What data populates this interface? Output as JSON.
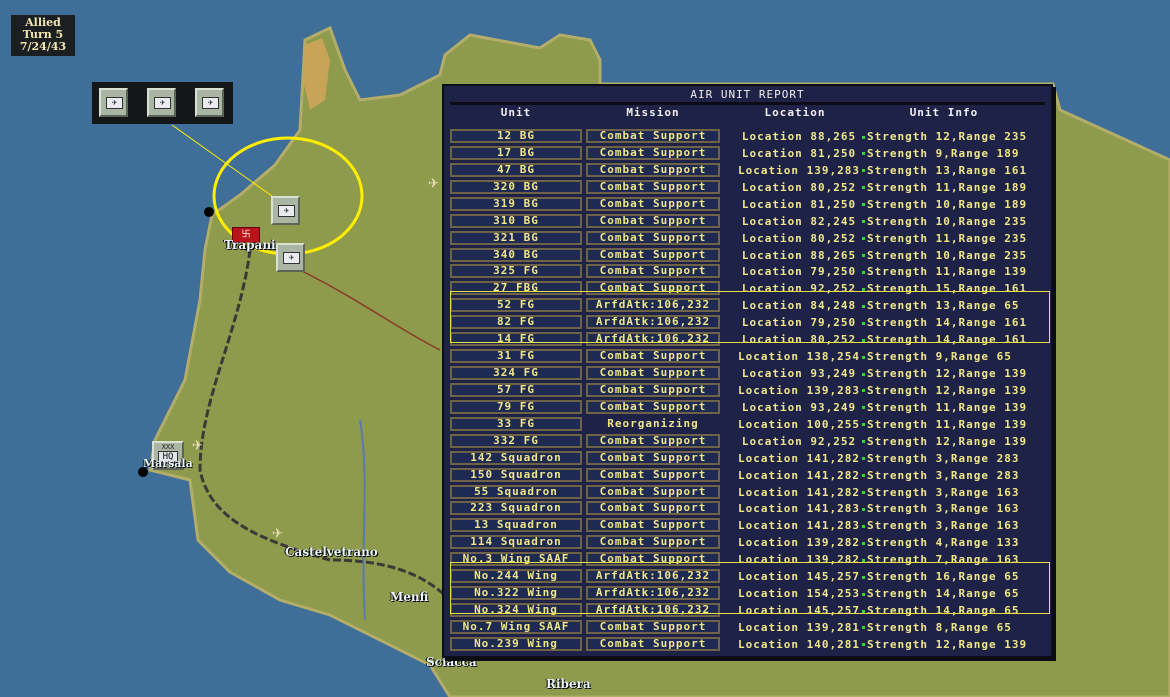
{
  "turn_info": {
    "side": "Allied",
    "turn": "Turn 5",
    "date": "7/24/43"
  },
  "map": {
    "labels": [
      "Trapani",
      "Marsala",
      "Castelvetrano",
      "Menfi",
      "Sciacca",
      "Ribera"
    ],
    "hq_label": "HQ",
    "hq_size": "XXX",
    "colors": {
      "sea": "#3f6f99",
      "land": "#8e9a4c",
      "selection": "#ffee00"
    }
  },
  "report": {
    "title": "AIR UNIT REPORT",
    "headers": [
      "Unit",
      "Mission",
      "Location",
      "Unit Info"
    ],
    "rows": [
      {
        "unit": "12 BG",
        "mission": "Combat Support",
        "location": "Location 88,265",
        "info": "Strength 12,Range 235"
      },
      {
        "unit": "17 BG",
        "mission": "Combat Support",
        "location": "Location 81,250",
        "info": "Strength 9,Range 189"
      },
      {
        "unit": "47 BG",
        "mission": "Combat Support",
        "location": "Location 139,283",
        "info": "Strength 13,Range 161"
      },
      {
        "unit": "320 BG",
        "mission": "Combat Support",
        "location": "Location 80,252",
        "info": "Strength 11,Range 189"
      },
      {
        "unit": "319 BG",
        "mission": "Combat Support",
        "location": "Location 81,250",
        "info": "Strength 10,Range 189"
      },
      {
        "unit": "310 BG",
        "mission": "Combat Support",
        "location": "Location 82,245",
        "info": "Strength 10,Range 235"
      },
      {
        "unit": "321 BG",
        "mission": "Combat Support",
        "location": "Location 80,252",
        "info": "Strength 11,Range 235"
      },
      {
        "unit": "340 BG",
        "mission": "Combat Support",
        "location": "Location 88,265",
        "info": "Strength 10,Range 235"
      },
      {
        "unit": "325 FG",
        "mission": "Combat Support",
        "location": "Location 79,250",
        "info": "Strength 11,Range 139"
      },
      {
        "unit": "27 FBG",
        "mission": "Combat Support",
        "location": "Location 92,252",
        "info": "Strength 15,Range 161"
      },
      {
        "unit": "52 FG",
        "mission": "ArfdAtk:106,232",
        "location": "Location 84,248",
        "info": "Strength 13,Range 65"
      },
      {
        "unit": "82 FG",
        "mission": "ArfdAtk:106,232",
        "location": "Location 79,250",
        "info": "Strength 14,Range 161"
      },
      {
        "unit": "14 FG",
        "mission": "ArfdAtk:106,232",
        "location": "Location 80,252",
        "info": "Strength 14,Range 161"
      },
      {
        "unit": "31 FG",
        "mission": "Combat Support",
        "location": "Location 138,254",
        "info": "Strength 9,Range 65"
      },
      {
        "unit": "324 FG",
        "mission": "Combat Support",
        "location": "Location 93,249",
        "info": "Strength 12,Range 139"
      },
      {
        "unit": "57 FG",
        "mission": "Combat Support",
        "location": "Location 139,283",
        "info": "Strength 12,Range 139"
      },
      {
        "unit": "79 FG",
        "mission": "Combat Support",
        "location": "Location 93,249",
        "info": "Strength 11,Range 139"
      },
      {
        "unit": "33 FG",
        "mission": "Reorganizing",
        "location": "Location 100,255",
        "info": "Strength 11,Range 139"
      },
      {
        "unit": "332 FG",
        "mission": "Combat Support",
        "location": "Location 92,252",
        "info": "Strength 12,Range 139"
      },
      {
        "unit": "142 Squadron",
        "mission": "Combat Support",
        "location": "Location 141,282",
        "info": "Strength 3,Range 283"
      },
      {
        "unit": "150 Squadron",
        "mission": "Combat Support",
        "location": "Location 141,282",
        "info": "Strength 3,Range 283"
      },
      {
        "unit": "55 Squadron",
        "mission": "Combat Support",
        "location": "Location 141,282",
        "info": "Strength 3,Range 163"
      },
      {
        "unit": "223 Squadron",
        "mission": "Combat Support",
        "location": "Location 141,283",
        "info": "Strength 3,Range 163"
      },
      {
        "unit": "13 Squadron",
        "mission": "Combat Support",
        "location": "Location 141,283",
        "info": "Strength 3,Range 163"
      },
      {
        "unit": "114 Squadron",
        "mission": "Combat Support",
        "location": "Location 139,282",
        "info": "Strength 4,Range 133"
      },
      {
        "unit": "No.3 Wing SAAF",
        "mission": "Combat Support",
        "location": "Location 139,282",
        "info": "Strength 7,Range 163"
      },
      {
        "unit": "No.244 Wing",
        "mission": "ArfdAtk:106,232",
        "location": "Location 145,257",
        "info": "Strength 16,Range 65"
      },
      {
        "unit": "No.322 Wing",
        "mission": "ArfdAtk:106,232",
        "location": "Location 154,253",
        "info": "Strength 14,Range 65"
      },
      {
        "unit": "No.324 Wing",
        "mission": "ArfdAtk:106,232",
        "location": "Location 145,257",
        "info": "Strength 14,Range 65"
      },
      {
        "unit": "No.7 Wing SAAF",
        "mission": "Combat Support",
        "location": "Location 139,281",
        "info": "Strength 8,Range 65"
      },
      {
        "unit": "No.239 Wing",
        "mission": "Combat Support",
        "location": "Location 140,281",
        "info": "Strength 12,Range 139"
      }
    ]
  }
}
